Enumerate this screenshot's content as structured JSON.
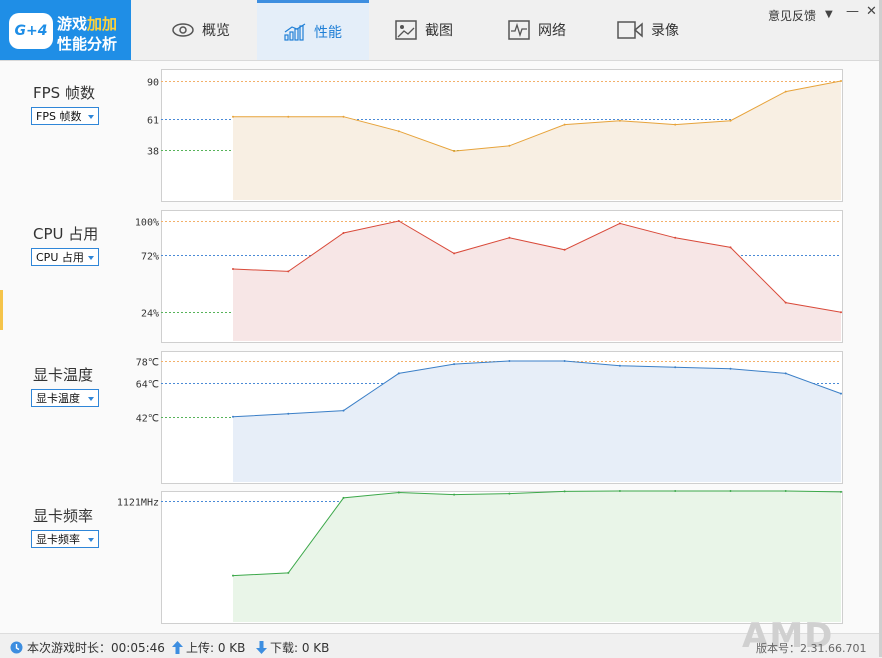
{
  "app": {
    "logo_badge": "G+4",
    "logo_line1a": "游戏",
    "logo_line1b": "加加",
    "logo_line2": "性能分析"
  },
  "tabs": [
    {
      "label": "概览",
      "icon": "eye-icon"
    },
    {
      "label": "性能",
      "icon": "performance-chart-icon",
      "active": true
    },
    {
      "label": "截图",
      "icon": "screenshot-image-icon"
    },
    {
      "label": "网络",
      "icon": "network-pulse-icon"
    },
    {
      "label": "录像",
      "icon": "video-record-icon"
    }
  ],
  "header": {
    "feedback": "意见反馈",
    "menu_icon": "▼",
    "minimize": "—",
    "close": "✕"
  },
  "metrics": [
    {
      "title": "FPS 帧数",
      "select": "FPS 帧数"
    },
    {
      "title": "CPU 占用",
      "select": "CPU 占用"
    },
    {
      "title": "显卡温度",
      "select": "显卡温度"
    },
    {
      "title": "显卡频率",
      "select": "显卡频率"
    }
  ],
  "chart_data": [
    {
      "type": "area",
      "tick_labels": [
        "90",
        "61",
        "38"
      ],
      "ticks": [
        90,
        61,
        38
      ],
      "tick_colors": [
        "#f2b06a",
        "#4a8ad6",
        "#57b35a"
      ],
      "ylim": [
        0,
        90
      ],
      "values": [
        63,
        63,
        63,
        52,
        37,
        41,
        57,
        60,
        57,
        60,
        82,
        90
      ],
      "line_color": "#e7a33a",
      "fill_color": "#f8efe3"
    },
    {
      "type": "area",
      "tick_labels": [
        "100%",
        "72%",
        "24%"
      ],
      "ticks": [
        100,
        72,
        24
      ],
      "tick_colors": [
        "#f2b06a",
        "#4a8ad6",
        "#57b35a"
      ],
      "ylim": [
        0,
        100
      ],
      "values": [
        60,
        58,
        90,
        100,
        73,
        86,
        76,
        98,
        86,
        78,
        32,
        24
      ],
      "line_color": "#d94a3a",
      "fill_color": "#f7e6e6"
    },
    {
      "type": "area",
      "tick_labels": [
        "78℃",
        "64℃",
        "42℃"
      ],
      "ticks": [
        78,
        64,
        42
      ],
      "tick_colors": [
        "#f2b06a",
        "#4a8ad6",
        "#57b35a"
      ],
      "ylim": [
        0,
        78
      ],
      "values": [
        42,
        44,
        46,
        70,
        76,
        78,
        78,
        75,
        74,
        73,
        70,
        57
      ],
      "line_color": "#3b7fc7",
      "fill_color": "#e7eef8"
    },
    {
      "type": "area",
      "tick_labels": [
        "1121MHz"
      ],
      "ticks": [
        1121
      ],
      "tick_colors": [
        "#4a8ad6"
      ],
      "ylim": [
        0,
        1121
      ],
      "values": [
        430,
        455,
        1150,
        1200,
        1180,
        1190,
        1210,
        1220,
        1230,
        1215,
        1225,
        1205
      ],
      "line_color": "#3ca84a",
      "fill_color": "#e9f5e8"
    }
  ],
  "status": {
    "clock_icon": "clock-icon",
    "session_time": "本次游戏时长：00:05:46",
    "upload_icon": "upload-arrow-icon",
    "upload": "上传: 0 KB",
    "download_icon": "download-arrow-icon",
    "download": "下载: 0 KB",
    "brand": "AMD",
    "version": "版本号：2.31.66.701"
  },
  "colors": {
    "accent": "#1f8ee6",
    "active_tab_bg": "#e4eef9"
  }
}
